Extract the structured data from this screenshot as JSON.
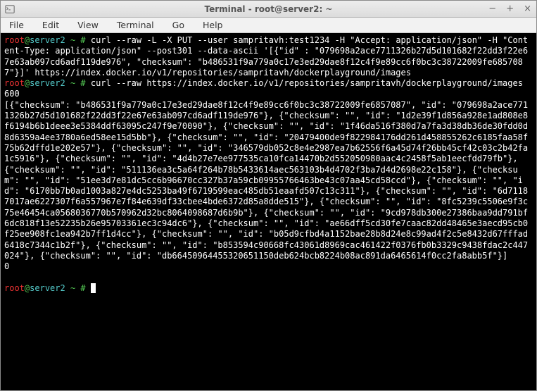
{
  "window": {
    "title": "Terminal - root@server2: ~",
    "controls": {
      "min": "−",
      "max": "+",
      "close": "×"
    }
  },
  "menu": {
    "file": "File",
    "edit": "Edit",
    "view": "View",
    "terminal": "Terminal",
    "go": "Go",
    "help": "Help"
  },
  "prompt": {
    "user": "root",
    "at": "@",
    "host": "server2",
    "path_sep": " ~ # "
  },
  "commands": {
    "cmd1": "curl --raw -L -X PUT --user sampritavh:test1234 -H \"Accept: application/json\" -H \"Content-Type: application/json\" --post301 --data-ascii '[{\"id\" : \"079698a2ace7711326b27d5d101682f22dd3f22e67e63ab097cd6adf119de976\", \"checksum\": \"b486531f9a779a0c17e3ed29dae8f12c4f9e89cc6f0bc3c38722009fe6857087\"}]' https://index.docker.io/v1/repositories/sampritavh/dockerplayground/images",
    "cmd2": "curl --raw https://index.docker.io/v1/repositories/sampritavh/dockerplayground/images"
  },
  "output": {
    "len": "600",
    "body": "[{\"checksum\": \"b486531f9a779a0c17e3ed29dae8f12c4f9e89cc6f0bc3c38722009fe6857087\", \"id\": \"079698a2ace7711326b27d5d101682f22dd3f22e67e63ab097cd6adf119de976\"}, {\"checksum\": \"\", \"id\": \"1d2e39f1d856a928e1ad808e8f6194b6b1deee3e5384ddf63095c247f9e70090\"}, {\"checksum\": \"\", \"id\": \"1f46da516f380d7a7fa3d38db36de30fdd0d8d6359a4ee3780a6ed58ee15d5bb\"}, {\"checksum\": \"\", \"id\": \"20479400de9f822984176dd261d458855262c6185faa58f75b62dffd1e202e57\"}, {\"checksum\": \"\", \"id\": \"346579db052c8e4e2987ea7b62556f6a45d74f26bb45cf42c03c2b42fa1c5916\"}, {\"checksum\": \"\", \"id\": \"4d4b27e7ee977535ca10fca14470b2d552050980aac4c2458f5ab1eecfdd79fb\"}, {\"checksum\": \"\", \"id\": \"511136ea3c5a64f264b78b5433614aec563103b4d4702f3ba7d4d2698e22c158\"}, {\"checksum\": \"\", \"id\": \"51ee3d7e81dc5cc6b96670cc327b37a59cb09955766463be43c07aa45cd58ccd\"}, {\"checksum\": \"\", \"id\": \"6170bb7b0ad1003a827e4dc5253ba49f6719599eac485db51eaafd507c13c311\"}, {\"checksum\": \"\", \"id\": \"6d71187017ae6227307f6a557967e7f84e639df33cbee4bde6372d85a8dde515\"}, {\"checksum\": \"\", \"id\": \"8fc5239c5506e9f3c75e46454ca0568036770b570962d32bc8064098687d6b9b\"}, {\"checksum\": \"\", \"id\": \"9cd978db300e27386baa9dd791bf6dc818f13e52235b26e95703361ec3c94dc6\"}, {\"checksum\": \"\", \"id\": \"ae66dff5cd30fe7caac82dd48465e3aecd95cb0f25ee908fc1ea942b7ff1d4cc\"}, {\"checksum\": \"\", \"id\": \"b05d9cfbd4a1152bae28b8d24e8c99ad4f2c5e8432d67fffad6418c7344c1b2f\"}, {\"checksum\": \"\", \"id\": \"b853594c90668fc43061d8969cac461422f0376fb0b3329c9438fdac2c447024\"}, {\"checksum\": \"\", \"id\": \"db66450964455320651150deb624bcb8224b08ac891da6465614f0cc2fa8abb5f\"}]",
    "trailer": "0",
    "blank": ""
  }
}
